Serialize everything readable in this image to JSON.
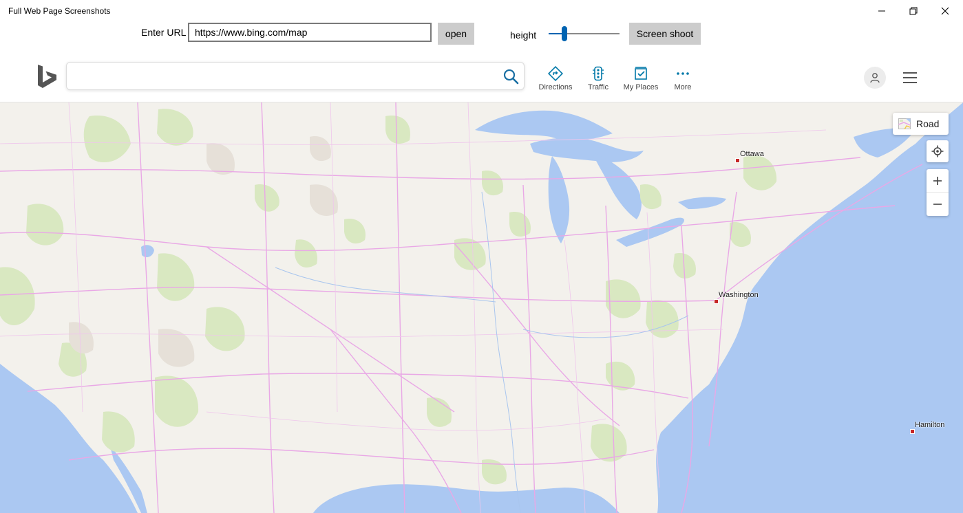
{
  "window": {
    "title": "Full Web Page Screenshots",
    "controls": [
      "minimize-icon",
      "restore-icon",
      "close-icon"
    ]
  },
  "toolbar": {
    "url_label": "Enter URL",
    "url_value": "https://www.bing.com/map",
    "open_label": "open",
    "height_label": "height",
    "height_slider_fraction": 0.2,
    "screenshot_label": "Screen shoot"
  },
  "bing": {
    "logo": "bing-logo-icon",
    "search_value": "",
    "nav": [
      {
        "label": "Directions",
        "icon": "directions-icon"
      },
      {
        "label": "Traffic",
        "icon": "traffic-icon"
      },
      {
        "label": "My Places",
        "icon": "my-places-icon"
      },
      {
        "label": "More",
        "icon": "more-icon"
      }
    ],
    "accent": "#0078a8"
  },
  "map": {
    "style_label": "Road",
    "cities": [
      {
        "name": "Ottawa"
      },
      {
        "name": "Washington"
      },
      {
        "name": "Hamilton"
      }
    ],
    "colors": {
      "land": "#f3f1ec",
      "water": "#abc8f2",
      "park": "#d9e8c1",
      "road": "#e9a8e6"
    }
  }
}
